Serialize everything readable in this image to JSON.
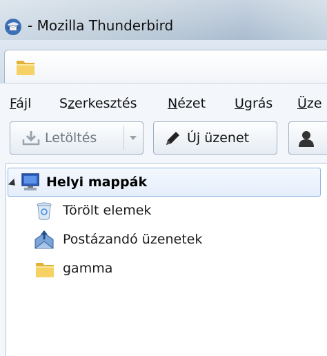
{
  "window": {
    "title": " - Mozilla Thunderbird",
    "app_icon": "thunderbird-icon"
  },
  "tabs": [
    {
      "icon": "folder-icon",
      "label": ""
    }
  ],
  "menubar": {
    "items": [
      {
        "accel": "F",
        "rest": "ájl"
      },
      {
        "pre": "S",
        "accel": "z",
        "rest": "erkesztés"
      },
      {
        "accel": "N",
        "rest": "ézet"
      },
      {
        "accel": "U",
        "rest": "grás"
      },
      {
        "accel": "Ü",
        "rest": "ze"
      }
    ]
  },
  "toolbar": {
    "download_label": "Letöltés",
    "new_message_label": "Új üzenet",
    "download_icon": "download-icon",
    "new_message_icon": "pencil-icon",
    "address_book_icon": "address-book-icon"
  },
  "folder_tree": {
    "root": {
      "label": "Helyi mappák",
      "icon": "local-folders-icon",
      "expanded": true
    },
    "children": [
      {
        "label": "Törölt elemek",
        "icon": "trash-icon"
      },
      {
        "label": "Postázandó üzenetek",
        "icon": "outbox-icon"
      },
      {
        "label": "gamma",
        "icon": "folder-icon"
      }
    ]
  },
  "colors": {
    "selection_border": "#8db2e3",
    "folder_yellow": "#f2c94c"
  }
}
